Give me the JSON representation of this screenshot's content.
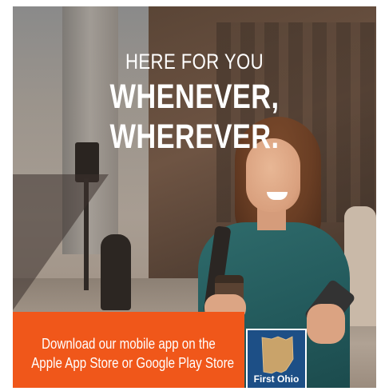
{
  "headline": {
    "line1": "HERE FOR YOU",
    "line2": "WHENEVER, WHEREVER."
  },
  "cta": {
    "line1": "Download our mobile app on the",
    "line2": "Apple App Store or Google Play Store",
    "background_color": "#f0571a"
  },
  "logo": {
    "text": "First Ohio",
    "icon": "ohio-state-icon",
    "background_color": "#1d4f86",
    "state_color": "#c9a36a"
  }
}
